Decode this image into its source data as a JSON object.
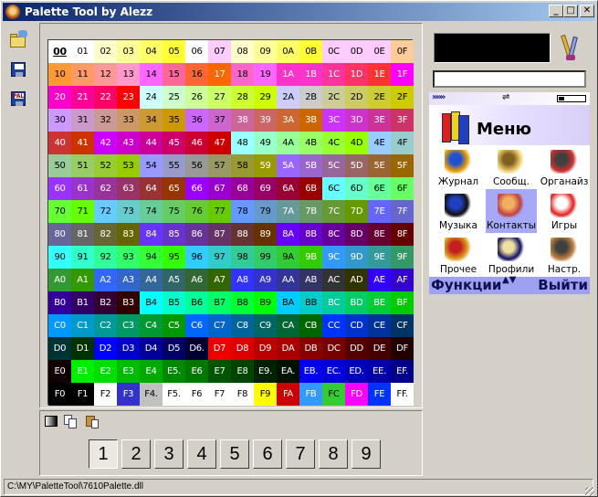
{
  "window": {
    "title": "Palette Tool by Alezz",
    "min": "_",
    "max": "□",
    "close": "✕"
  },
  "toolbar": {
    "open_icon": "open-folder-icon",
    "save_icon": "floppy-disk-icon",
    "saveas_icon": "save-palette-icon",
    "saveas_badge": "PAL"
  },
  "palette": {
    "selected": "00",
    "colors": [
      "#ffffff",
      "#ffffff",
      "#ffffcc",
      "#ffff99",
      "#ffff66",
      "#ffff33",
      "#ffffff",
      "#ffccff",
      "#ffffcc",
      "#ffff99",
      "#ffff66",
      "#ffff33",
      "#ffccff",
      "#ffccff",
      "#ffccff",
      "#ffcc99",
      "#ff9933",
      "#ff9966",
      "#ff9999",
      "#ff99cc",
      "#ff66ff",
      "#ff6699",
      "#ff6633",
      "#ff6600",
      "#ff66cc",
      "#ff66ff",
      "#ff33cc",
      "#ff33cc",
      "#ff3399",
      "#ff3366",
      "#ff3333",
      "#ff00ff",
      "#ff00cc",
      "#ff0099",
      "#ff0066",
      "#ff0000",
      "#ccffff",
      "#ccffcc",
      "#ccff99",
      "#ccff66",
      "#ccff33",
      "#ccff00",
      "#ccccff",
      "#cccccc",
      "#cccc99",
      "#cccc66",
      "#cccc33",
      "#cccc00",
      "#cc99ff",
      "#cc99cc",
      "#cc9999",
      "#cc9966",
      "#cc9933",
      "#cc9900",
      "#cc66ff",
      "#cc66cc",
      "#cc6699",
      "#cc6666",
      "#cc6633",
      "#cc6600",
      "#cc33ff",
      "#cc33cc",
      "#cc3399",
      "#cc3366",
      "#cc3333",
      "#cc3300",
      "#cc00ff",
      "#cc00cc",
      "#cc0099",
      "#cc0066",
      "#cc0033",
      "#cc0000",
      "#99ffff",
      "#99ffcc",
      "#99ff99",
      "#99ff66",
      "#99ff33",
      "#99ff00",
      "#99ccff",
      "#99cccc",
      "#99cc99",
      "#99cc66",
      "#99cc33",
      "#99cc00",
      "#9999ff",
      "#9999cc",
      "#999999",
      "#999966",
      "#999933",
      "#999900",
      "#9966ff",
      "#9966cc",
      "#996699",
      "#996666",
      "#996633",
      "#996600",
      "#9933ff",
      "#9933cc",
      "#993399",
      "#993366",
      "#993333",
      "#993300",
      "#9900ff",
      "#9900cc",
      "#990099",
      "#990066",
      "#990033",
      "#990000",
      "#66ffff",
      "#66ffcc",
      "#66ff99",
      "#66ff66",
      "#66ff33",
      "#66ff00",
      "#66ccff",
      "#66cccc",
      "#66cc99",
      "#66cc66",
      "#66cc33",
      "#66cc00",
      "#6699ff",
      "#6699cc",
      "#669999",
      "#669966",
      "#669933",
      "#669900",
      "#6666ff",
      "#6666cc",
      "#666699",
      "#666666",
      "#666633",
      "#666600",
      "#6633ff",
      "#6633cc",
      "#663399",
      "#663366",
      "#663333",
      "#663300",
      "#6600ff",
      "#6600cc",
      "#660099",
      "#660066",
      "#660033",
      "#660000",
      "#33ffff",
      "#33ffcc",
      "#33ff99",
      "#33ff66",
      "#33ff33",
      "#33ff00",
      "#33ccff",
      "#33cccc",
      "#33cc99",
      "#33cc66",
      "#33cc33",
      "#33cc00",
      "#3399ff",
      "#3399cc",
      "#339999",
      "#339966",
      "#339933",
      "#339900",
      "#3366ff",
      "#3366cc",
      "#336699",
      "#336666",
      "#336633",
      "#336600",
      "#3333ff",
      "#3333cc",
      "#333399",
      "#333366",
      "#333333",
      "#333300",
      "#3300ff",
      "#3300cc",
      "#330099",
      "#330066",
      "#330033",
      "#330000",
      "#00ffff",
      "#00ffcc",
      "#00ff99",
      "#00ff66",
      "#00ff33",
      "#00ff00",
      "#00ccff",
      "#00cccc",
      "#00cc99",
      "#00cc66",
      "#00cc33",
      "#00cc00",
      "#0099ff",
      "#0099cc",
      "#009999",
      "#009966",
      "#009933",
      "#009900",
      "#0066ff",
      "#0066cc",
      "#006699",
      "#006666",
      "#006633",
      "#006600",
      "#0033ff",
      "#0033cc",
      "#003399",
      "#003366",
      "#003333",
      "#003300",
      "#0000ff",
      "#0000cc",
      "#000099",
      "#000066",
      "#000033",
      "#ee0000",
      "#dd0000",
      "#bb0000",
      "#aa0000",
      "#880000",
      "#770000",
      "#550000",
      "#440000",
      "#220000",
      "#110000",
      "#00ee00",
      "#00dd00",
      "#00bb00",
      "#00aa00",
      "#008800",
      "#007700",
      "#005500",
      "#004400",
      "#002200",
      "#001100",
      "#0000ee",
      "#0000dd",
      "#0000bb",
      "#0000aa",
      "#000088",
      "#000000",
      "#000000",
      "#ffffff",
      "#3333cc",
      "#c0c0c0",
      "#ffffff",
      "#ffffff",
      "#ffffff",
      "#ffffff",
      "#ffff00",
      "#cc0000",
      "#3399ff",
      "#33cc33",
      "#ff00ff",
      "#0033ff",
      "#ffffff"
    ],
    "labels": [
      "00",
      "01",
      "02",
      "03",
      "04",
      "05",
      "06",
      "07",
      "08",
      "09",
      "0A",
      "0B",
      "0C",
      "0D",
      "0E",
      "0F",
      "10",
      "11",
      "12",
      "13",
      "14",
      "15",
      "16",
      "17",
      "18",
      "19",
      "1A",
      "1B",
      "1C",
      "1D",
      "1E",
      "1F",
      "20",
      "21",
      "22",
      "23",
      "24",
      "25",
      "26",
      "27",
      "28",
      "29",
      "2A",
      "2B",
      "2C",
      "2D",
      "2E",
      "2F",
      "30",
      "31",
      "32",
      "33",
      "34",
      "35",
      "36",
      "37",
      "38",
      "39",
      "3A",
      "3B",
      "3C",
      "3D",
      "3E",
      "3F",
      "40",
      "41",
      "42",
      "43",
      "44",
      "45",
      "46",
      "47",
      "48",
      "49",
      "4A",
      "4B",
      "4C",
      "4D",
      "4E",
      "4F",
      "50",
      "51",
      "52",
      "53",
      "54",
      "55",
      "56",
      "57",
      "58",
      "59",
      "5A",
      "5B",
      "5C",
      "5D",
      "5E",
      "5F",
      "60",
      "61",
      "62",
      "63",
      "64",
      "65",
      "66",
      "67",
      "68",
      "69",
      "6A",
      "6B",
      "6C",
      "6D",
      "6E",
      "6F",
      "70",
      "71",
      "72",
      "73",
      "74",
      "75",
      "76",
      "77",
      "78",
      "79",
      "7A",
      "7B",
      "7C",
      "7D",
      "7E",
      "7F",
      "80",
      "81",
      "82",
      "83",
      "84",
      "85",
      "86",
      "87",
      "88",
      "89",
      "8A",
      "8B",
      "8C",
      "8D",
      "8E",
      "8F",
      "90",
      "91",
      "92",
      "93",
      "94",
      "95",
      "96",
      "97",
      "98",
      "99",
      "9A",
      "9B",
      "9C",
      "9D",
      "9E",
      "9F",
      "A0",
      "A1",
      "A2",
      "A3",
      "A4",
      "A5",
      "A6",
      "A7",
      "A8",
      "A9",
      "AA",
      "AB",
      "AC",
      "AD",
      "AE",
      "AF",
      "B0",
      "B1",
      "B2",
      "B3",
      "B4",
      "B5",
      "B6",
      "B7",
      "B8",
      "B9",
      "BA",
      "BB",
      "BC",
      "BD",
      "BE",
      "BF",
      "C0",
      "C1",
      "C2",
      "C3",
      "C4",
      "C5",
      "C6",
      "C7",
      "C8",
      "C9",
      "CA",
      "CB",
      "CC",
      "CD",
      "CE",
      "CF",
      "D0",
      "D1",
      "D2",
      "D3",
      "D4",
      "D5",
      "D6.",
      "D7",
      "D8",
      "D9",
      "DA",
      "DB",
      "DC",
      "DD",
      "DE",
      "DF",
      "E0",
      "E1",
      "E2",
      "E3",
      "E4",
      "E5.",
      "E6",
      "E7",
      "E8",
      "E9.",
      "EA.",
      "EB.",
      "EC.",
      "ED.",
      "EE.",
      "EF.",
      "F0",
      "F1",
      "F2",
      "F3",
      "F4.",
      "F5.",
      "F6",
      "F7",
      "F8",
      "F9",
      "FA",
      "FB",
      "FC",
      "FD",
      "FE",
      "FF."
    ]
  },
  "bottom_toolbar": {
    "grad_icon": "gradient-icon",
    "copy_icon": "copy-icon",
    "paste_icon": "paste-icon"
  },
  "pages": [
    "1",
    "2",
    "3",
    "4",
    "5",
    "6",
    "7",
    "8",
    "9"
  ],
  "active_page": "1",
  "preview": {
    "color": "#000000",
    "hex_value": "",
    "brush_icon": "brushes-icon"
  },
  "phone": {
    "status_arrows": "»»»",
    "usb": "⇌",
    "header_title": "Меню",
    "apps": [
      {
        "label": "Журнал",
        "icon": "log-icon"
      },
      {
        "label": "Сообщ.",
        "icon": "messages-icon"
      },
      {
        "label": "Органайз",
        "icon": "organizer-icon"
      },
      {
        "label": "Музыка",
        "icon": "music-icon"
      },
      {
        "label": "Контакты",
        "icon": "contacts-icon"
      },
      {
        "label": "Игры",
        "icon": "games-icon"
      },
      {
        "label": "Прочее",
        "icon": "other-icon"
      },
      {
        "label": "Профили",
        "icon": "profiles-icon"
      },
      {
        "label": "Настр.",
        "icon": "settings-icon"
      }
    ],
    "highlighted_app": "Контакты",
    "soft_left": "Функции",
    "soft_right": "Выйти",
    "soft_arrows": "▲▼",
    "highlight_color": "#a6a8f8"
  },
  "statusbar": {
    "path": "C:\\MY\\PaletteTool\\7610Palette.dll"
  }
}
